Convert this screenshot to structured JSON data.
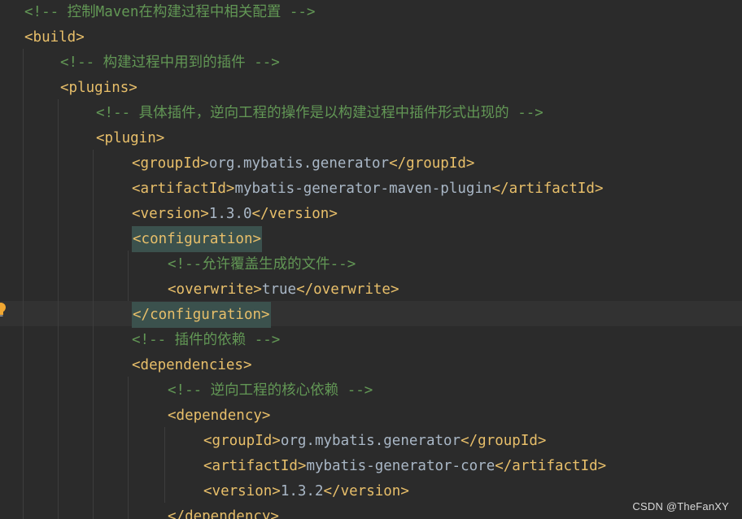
{
  "editor": {
    "lines": [
      {
        "indent": 0,
        "kind": "comment",
        "text": "<!-- 控制Maven在构建过程中相关配置 -->"
      },
      {
        "indent": 0,
        "kind": "tag",
        "text": "<build>"
      },
      {
        "indent": 1,
        "kind": "comment",
        "text": "<!-- 构建过程中用到的插件 -->"
      },
      {
        "indent": 1,
        "kind": "tag",
        "text": "<plugins>"
      },
      {
        "indent": 2,
        "kind": "comment",
        "text": "<!-- 具体插件，逆向工程的操作是以构建过程中插件形式出现的 -->"
      },
      {
        "indent": 2,
        "kind": "tag",
        "text": "<plugin>"
      },
      {
        "indent": 3,
        "kind": "element",
        "open": "<groupId>",
        "value": "org.mybatis.generator",
        "close": "</groupId>"
      },
      {
        "indent": 3,
        "kind": "element",
        "open": "<artifactId>",
        "value": "mybatis-generator-maven-plugin",
        "close": "</artifactId>"
      },
      {
        "indent": 3,
        "kind": "element",
        "open": "<version>",
        "value": "1.3.0",
        "close": "</version>"
      },
      {
        "indent": 3,
        "kind": "tag",
        "text": "<configuration>",
        "highlight": true
      },
      {
        "indent": 4,
        "kind": "comment",
        "text": "<!--允许覆盖生成的文件-->"
      },
      {
        "indent": 4,
        "kind": "element",
        "open": "<overwrite>",
        "value": "true",
        "close": "</overwrite>"
      },
      {
        "indent": 3,
        "kind": "tag",
        "text": "</configuration>",
        "highlight": true,
        "current": true
      },
      {
        "indent": 3,
        "kind": "comment",
        "text": "<!-- 插件的依赖 -->"
      },
      {
        "indent": 3,
        "kind": "tag",
        "text": "<dependencies>"
      },
      {
        "indent": 4,
        "kind": "comment",
        "text": "<!-- 逆向工程的核心依赖 -->"
      },
      {
        "indent": 4,
        "kind": "tag",
        "text": "<dependency>"
      },
      {
        "indent": 5,
        "kind": "element",
        "open": "<groupId>",
        "value": "org.mybatis.generator",
        "close": "</groupId>"
      },
      {
        "indent": 5,
        "kind": "element",
        "open": "<artifactId>",
        "value": "mybatis-generator-core",
        "close": "</artifactId>"
      },
      {
        "indent": 5,
        "kind": "element",
        "open": "<version>",
        "value": "1.3.2",
        "close": "</version>"
      },
      {
        "indent": 4,
        "kind": "tag",
        "text": "</dependency>"
      }
    ]
  },
  "colors": {
    "background": "#2b2b2b",
    "tag": "#e8bf6a",
    "text": "#a9b7c6",
    "comment": "#629755",
    "match_highlight": "#3b514d",
    "current_line": "#323232"
  },
  "gutter": {
    "intention_icon": "lightbulb-icon"
  },
  "watermark": "CSDN @TheFanXY"
}
